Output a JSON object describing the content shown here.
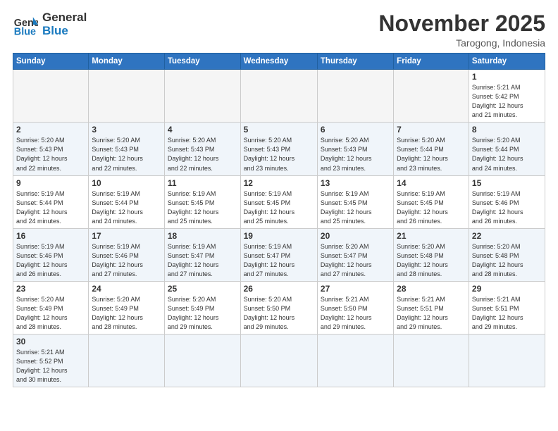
{
  "header": {
    "logo_general": "General",
    "logo_blue": "Blue",
    "month_title": "November 2025",
    "location": "Tarogong, Indonesia"
  },
  "weekdays": [
    "Sunday",
    "Monday",
    "Tuesday",
    "Wednesday",
    "Thursday",
    "Friday",
    "Saturday"
  ],
  "weeks": [
    [
      {
        "day": "",
        "info": ""
      },
      {
        "day": "",
        "info": ""
      },
      {
        "day": "",
        "info": ""
      },
      {
        "day": "",
        "info": ""
      },
      {
        "day": "",
        "info": ""
      },
      {
        "day": "",
        "info": ""
      },
      {
        "day": "1",
        "info": "Sunrise: 5:21 AM\nSunset: 5:42 PM\nDaylight: 12 hours\nand 21 minutes."
      }
    ],
    [
      {
        "day": "2",
        "info": "Sunrise: 5:20 AM\nSunset: 5:43 PM\nDaylight: 12 hours\nand 22 minutes."
      },
      {
        "day": "3",
        "info": "Sunrise: 5:20 AM\nSunset: 5:43 PM\nDaylight: 12 hours\nand 22 minutes."
      },
      {
        "day": "4",
        "info": "Sunrise: 5:20 AM\nSunset: 5:43 PM\nDaylight: 12 hours\nand 22 minutes."
      },
      {
        "day": "5",
        "info": "Sunrise: 5:20 AM\nSunset: 5:43 PM\nDaylight: 12 hours\nand 23 minutes."
      },
      {
        "day": "6",
        "info": "Sunrise: 5:20 AM\nSunset: 5:43 PM\nDaylight: 12 hours\nand 23 minutes."
      },
      {
        "day": "7",
        "info": "Sunrise: 5:20 AM\nSunset: 5:44 PM\nDaylight: 12 hours\nand 23 minutes."
      },
      {
        "day": "8",
        "info": "Sunrise: 5:20 AM\nSunset: 5:44 PM\nDaylight: 12 hours\nand 24 minutes."
      }
    ],
    [
      {
        "day": "9",
        "info": "Sunrise: 5:19 AM\nSunset: 5:44 PM\nDaylight: 12 hours\nand 24 minutes."
      },
      {
        "day": "10",
        "info": "Sunrise: 5:19 AM\nSunset: 5:44 PM\nDaylight: 12 hours\nand 24 minutes."
      },
      {
        "day": "11",
        "info": "Sunrise: 5:19 AM\nSunset: 5:45 PM\nDaylight: 12 hours\nand 25 minutes."
      },
      {
        "day": "12",
        "info": "Sunrise: 5:19 AM\nSunset: 5:45 PM\nDaylight: 12 hours\nand 25 minutes."
      },
      {
        "day": "13",
        "info": "Sunrise: 5:19 AM\nSunset: 5:45 PM\nDaylight: 12 hours\nand 25 minutes."
      },
      {
        "day": "14",
        "info": "Sunrise: 5:19 AM\nSunset: 5:45 PM\nDaylight: 12 hours\nand 26 minutes."
      },
      {
        "day": "15",
        "info": "Sunrise: 5:19 AM\nSunset: 5:46 PM\nDaylight: 12 hours\nand 26 minutes."
      }
    ],
    [
      {
        "day": "16",
        "info": "Sunrise: 5:19 AM\nSunset: 5:46 PM\nDaylight: 12 hours\nand 26 minutes."
      },
      {
        "day": "17",
        "info": "Sunrise: 5:19 AM\nSunset: 5:46 PM\nDaylight: 12 hours\nand 27 minutes."
      },
      {
        "day": "18",
        "info": "Sunrise: 5:19 AM\nSunset: 5:47 PM\nDaylight: 12 hours\nand 27 minutes."
      },
      {
        "day": "19",
        "info": "Sunrise: 5:19 AM\nSunset: 5:47 PM\nDaylight: 12 hours\nand 27 minutes."
      },
      {
        "day": "20",
        "info": "Sunrise: 5:20 AM\nSunset: 5:47 PM\nDaylight: 12 hours\nand 27 minutes."
      },
      {
        "day": "21",
        "info": "Sunrise: 5:20 AM\nSunset: 5:48 PM\nDaylight: 12 hours\nand 28 minutes."
      },
      {
        "day": "22",
        "info": "Sunrise: 5:20 AM\nSunset: 5:48 PM\nDaylight: 12 hours\nand 28 minutes."
      }
    ],
    [
      {
        "day": "23",
        "info": "Sunrise: 5:20 AM\nSunset: 5:49 PM\nDaylight: 12 hours\nand 28 minutes."
      },
      {
        "day": "24",
        "info": "Sunrise: 5:20 AM\nSunset: 5:49 PM\nDaylight: 12 hours\nand 28 minutes."
      },
      {
        "day": "25",
        "info": "Sunrise: 5:20 AM\nSunset: 5:49 PM\nDaylight: 12 hours\nand 29 minutes."
      },
      {
        "day": "26",
        "info": "Sunrise: 5:20 AM\nSunset: 5:50 PM\nDaylight: 12 hours\nand 29 minutes."
      },
      {
        "day": "27",
        "info": "Sunrise: 5:21 AM\nSunset: 5:50 PM\nDaylight: 12 hours\nand 29 minutes."
      },
      {
        "day": "28",
        "info": "Sunrise: 5:21 AM\nSunset: 5:51 PM\nDaylight: 12 hours\nand 29 minutes."
      },
      {
        "day": "29",
        "info": "Sunrise: 5:21 AM\nSunset: 5:51 PM\nDaylight: 12 hours\nand 29 minutes."
      }
    ],
    [
      {
        "day": "30",
        "info": "Sunrise: 5:21 AM\nSunset: 5:52 PM\nDaylight: 12 hours\nand 30 minutes."
      },
      {
        "day": "",
        "info": ""
      },
      {
        "day": "",
        "info": ""
      },
      {
        "day": "",
        "info": ""
      },
      {
        "day": "",
        "info": ""
      },
      {
        "day": "",
        "info": ""
      },
      {
        "day": "",
        "info": ""
      }
    ]
  ]
}
